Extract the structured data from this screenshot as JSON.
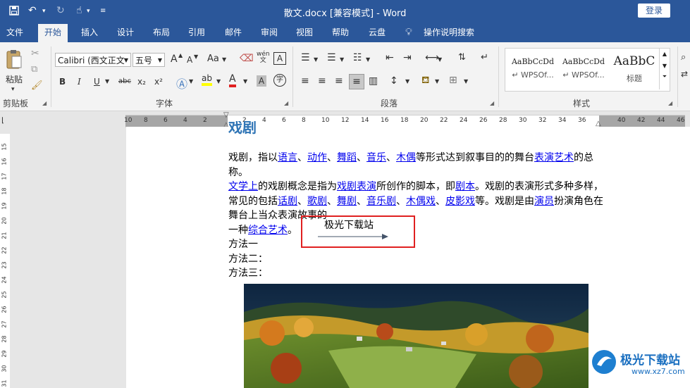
{
  "window": {
    "title": "散文.docx [兼容模式] - Word",
    "login_label": "登录"
  },
  "tabs": [
    "文件",
    "开始",
    "插入",
    "设计",
    "布局",
    "引用",
    "邮件",
    "审阅",
    "视图",
    "帮助",
    "云盘"
  ],
  "active_tab": "开始",
  "tell_me": "操作说明搜索",
  "ribbon": {
    "clipboard": {
      "paste_label": "粘贴",
      "group_label": "剪贴板"
    },
    "font": {
      "font_name": "Calibri (西文正文",
      "font_size": "五号",
      "group_label": "字体",
      "grow": "A",
      "shrink": "A",
      "case": "Aa",
      "phonetic": "wén",
      "bold": "B",
      "italic": "I",
      "underline": "U",
      "strike": "abc",
      "subscript": "x₂",
      "superscript": "x²",
      "enclose": "字"
    },
    "paragraph": {
      "group_label": "段落"
    },
    "styles": {
      "group_label": "样式",
      "items": [
        {
          "sample": "AaBbCcDd",
          "name": "↵ WPSOf..."
        },
        {
          "sample": "AaBbCcDd",
          "name": "↵ WPSOf..."
        },
        {
          "sample": "AaBbC",
          "name": "标题"
        }
      ]
    }
  },
  "ruler": {
    "ticks": [
      "10",
      "8",
      "6",
      "4",
      "2",
      "",
      "2",
      "4",
      "6",
      "8",
      "10",
      "12",
      "14",
      "16",
      "18",
      "20",
      "22",
      "24",
      "26",
      "28",
      "30",
      "32",
      "34",
      "36",
      "",
      "40",
      "42",
      "44",
      "46"
    ],
    "vticks": [
      "15",
      "16",
      "17",
      "18",
      "19",
      "20",
      "21",
      "22",
      "23",
      "24",
      "25",
      "26",
      "27",
      "28",
      "29",
      "30",
      "31"
    ]
  },
  "document": {
    "heading": "戏剧",
    "para1": [
      {
        "t": "戏剧，指以"
      },
      {
        "t": "语言",
        "link": true
      },
      {
        "t": "、"
      },
      {
        "t": "动作",
        "link": true
      },
      {
        "t": "、"
      },
      {
        "t": "舞蹈",
        "link": true
      },
      {
        "t": "、"
      },
      {
        "t": "音乐",
        "link": true
      },
      {
        "t": "、"
      },
      {
        "t": "木偶",
        "link": true
      },
      {
        "t": "等形式达到叙事目的的舞台"
      },
      {
        "t": "表演艺术",
        "link": true
      },
      {
        "t": "的总称。"
      }
    ],
    "para2": [
      {
        "t": "文学上",
        "link": true
      },
      {
        "t": "的戏剧概念是指为"
      },
      {
        "t": "戏剧表演",
        "link": true
      },
      {
        "t": "所创作的脚本，即"
      },
      {
        "t": "剧本",
        "link": true
      },
      {
        "t": "。戏剧的表演形式多种多样，"
      }
    ],
    "para3": [
      {
        "t": "常见的包括"
      },
      {
        "t": "话剧",
        "link": true
      },
      {
        "t": "、"
      },
      {
        "t": "歌剧",
        "link": true
      },
      {
        "t": "、"
      },
      {
        "t": "舞剧",
        "link": true
      },
      {
        "t": "、"
      },
      {
        "t": "音乐剧",
        "link": true
      },
      {
        "t": "、"
      },
      {
        "t": "木偶戏",
        "link": true
      },
      {
        "t": "、"
      },
      {
        "t": "皮影戏",
        "link": true
      },
      {
        "t": "等。戏剧是由"
      },
      {
        "t": "演员",
        "link": true
      },
      {
        "t": "扮演角色在"
      }
    ],
    "para4": [
      {
        "t": "舞台上当众表演故事的"
      }
    ],
    "para5": [
      {
        "t": "一种"
      },
      {
        "t": "综合艺术",
        "link": true
      },
      {
        "t": "。"
      }
    ],
    "method1": "方法一",
    "method2": "方法二：",
    "method3": "方法三：",
    "box_text": "极光下载站"
  },
  "watermark": {
    "text": "极光下载站",
    "url": "www.xz7.com"
  },
  "colors": {
    "accent": "#2b579a",
    "highlight_box": "#e02020",
    "link": "#0000ee"
  }
}
